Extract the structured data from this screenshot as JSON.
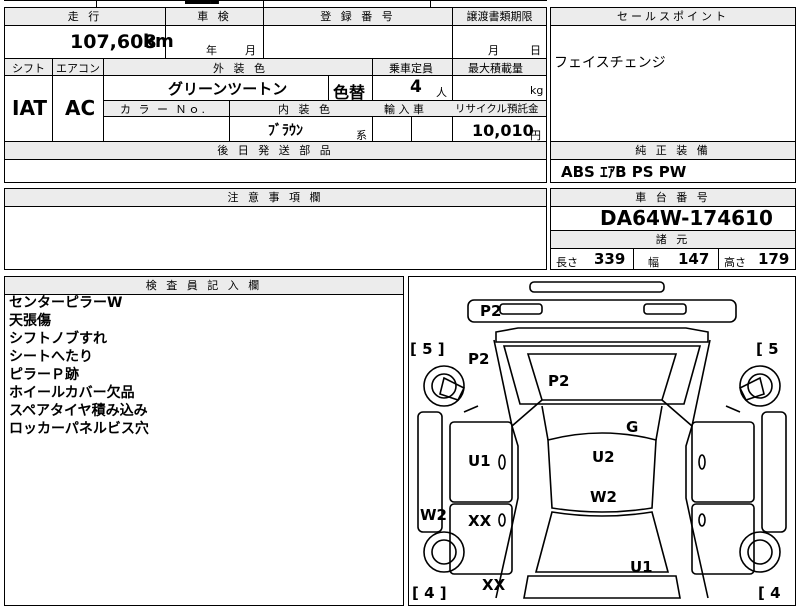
{
  "header": {
    "mileage_label": "走 行",
    "inspection_label": "車 検",
    "registration_label": "登 録 番 号",
    "transfer_label": "譲渡書類期限",
    "sales_point_label": "セールスポイント"
  },
  "values": {
    "mileage": "107,608",
    "mileage_unit": "km",
    "inspection_year": "年",
    "inspection_month": "月",
    "transfer_month": "月",
    "transfer_day": "日"
  },
  "specs": {
    "shift_label": "シフト",
    "aircon_label": "エアコン",
    "exterior_label": "外 装 色",
    "capacity_label": "乗車定員",
    "load_label": "最大積載量",
    "shift": "IAT",
    "aircon": "AC",
    "exterior_color": "グリーンツートン",
    "color_change": "色替",
    "capacity": "4",
    "capacity_unit": "人",
    "load_unit": "kg",
    "color_no_label": "カ ラ ー Ｎｏ.",
    "interior_label": "内 装 色",
    "import_label": "輸 入 車",
    "recycle_label": "リサイクル預託金",
    "interior_color": "ﾌﾞﾗｳﾝ",
    "interior_suffix": "系",
    "recycle_fee": "10,010",
    "recycle_unit": "円"
  },
  "sales_point": "フェイスチェンジ",
  "later_parts_label": "後 日 発 送 部 品",
  "equipment": {
    "label": "純 正 装 備",
    "value": "ABS  ｴｱB  PS  PW"
  },
  "caution_label": "注 意 事 項 欄",
  "chassis": {
    "label": "車 台 番 号",
    "value": "DA64W-174610"
  },
  "dimensions": {
    "label": "諸 元",
    "length_label": "長さ",
    "length": "339",
    "width_label": "幅",
    "width": "147",
    "height_label": "高さ",
    "height": "179"
  },
  "inspector": {
    "label": "検 査 員 記 入 欄",
    "notes": [
      "センターピラーW",
      "天張傷",
      "シフトノブすれ",
      "シートへたり",
      "ピラーＰ跡",
      "ホイールカバー欠品",
      "スペアタイヤ積み込み",
      "ロッカーパネルビス穴"
    ]
  },
  "diagram": {
    "marks": [
      "P2",
      "P2",
      "P2",
      "G",
      "U1",
      "U2",
      "W2",
      "W2",
      "XX",
      "XX",
      "U1"
    ],
    "tire_front_left": "5",
    "tire_front_right": "5",
    "tire_rear_left": "4",
    "tire_rear_right": "4"
  }
}
